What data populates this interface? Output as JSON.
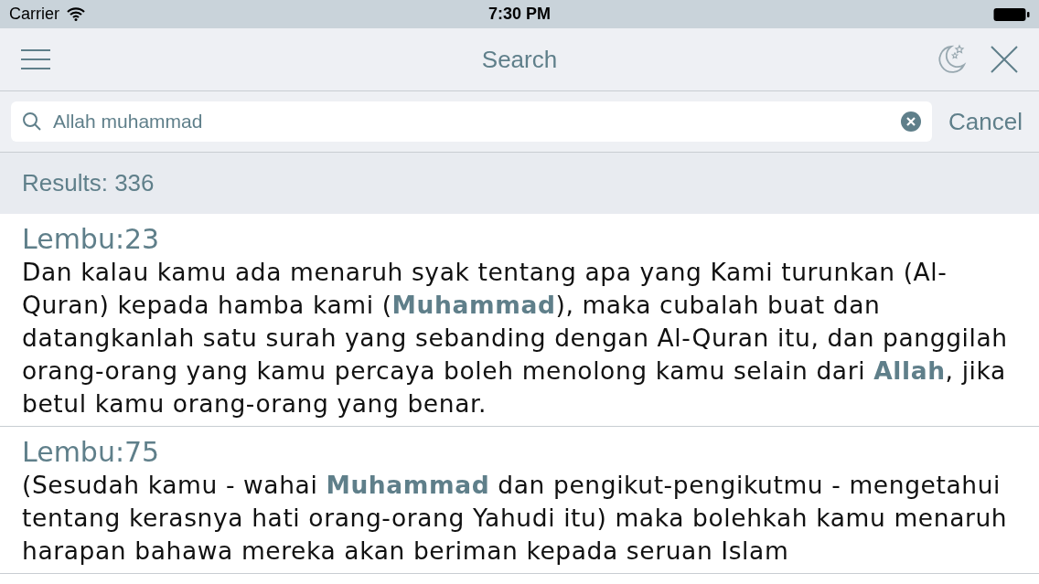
{
  "status_bar": {
    "carrier": "Carrier",
    "time": "7:30 PM"
  },
  "nav_bar": {
    "title": "Search"
  },
  "search": {
    "value": "Allah muhammad",
    "cancel": "Cancel"
  },
  "results_count": "Results: 336",
  "results": [
    {
      "reference": "Lembu:23",
      "text": "Dan kalau kamu ada menaruh syak tentang apa yang Kami turunkan (Al-Quran) kepada hamba kami (**Muhammad**), maka cubalah buat dan datangkanlah satu surah yang sebanding dengan Al-Quran itu, dan panggilah orang-orang yang kamu percaya boleh menolong kamu selain dari **Allah**, jika betul kamu orang-orang yang benar."
    },
    {
      "reference": "Lembu:75",
      "text": "(Sesudah kamu - wahai **Muhammad** dan pengikut-pengikutmu - mengetahui tentang kerasnya hati orang-orang Yahudi itu) maka bolehkah kamu menaruh harapan bahawa mereka akan beriman kepada seruan Islam"
    }
  ]
}
